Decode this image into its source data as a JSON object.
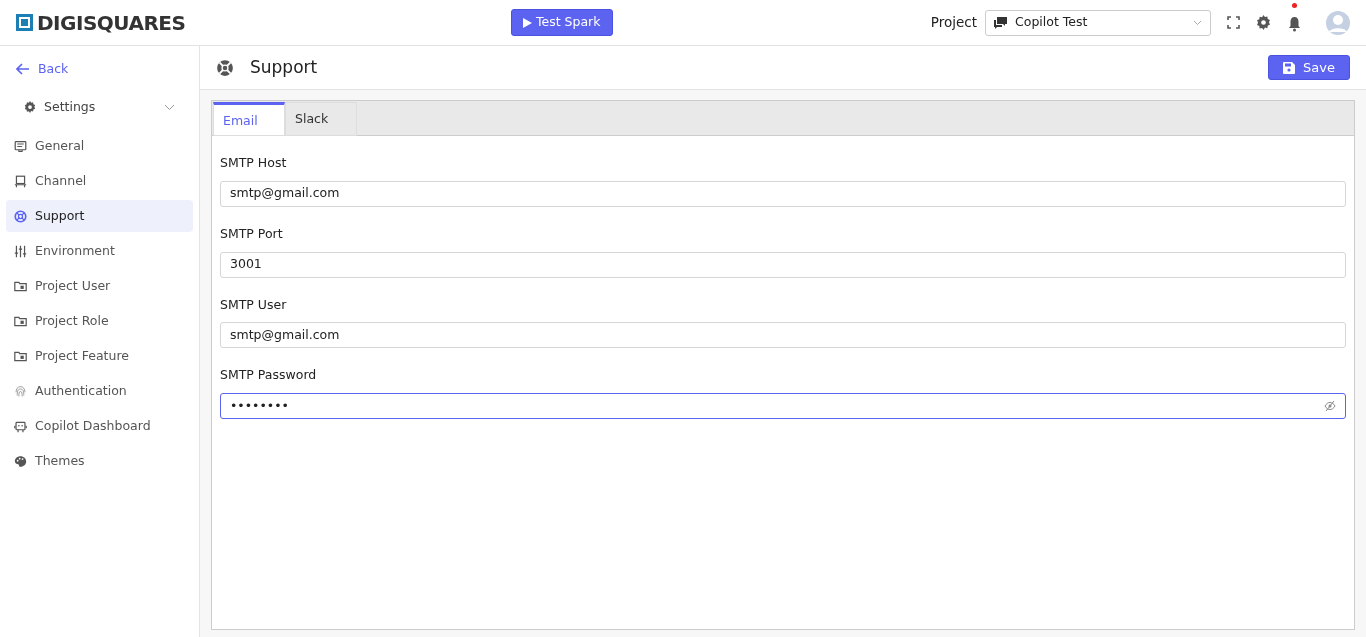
{
  "header": {
    "logo": "DIGISQUARES",
    "test_button": "Test Spark",
    "project_label": "Project",
    "project_select": "Copilot Test",
    "notification_dot": true
  },
  "sidebar": {
    "back": "Back",
    "group": {
      "label": "Settings",
      "expanded": true
    },
    "items": [
      {
        "label": "General",
        "selected": false
      },
      {
        "label": "Channel",
        "selected": false
      },
      {
        "label": "Support",
        "selected": true
      },
      {
        "label": "Environment",
        "selected": false
      },
      {
        "label": "Project User",
        "selected": false
      },
      {
        "label": "Project Role",
        "selected": false
      },
      {
        "label": "Project Feature",
        "selected": false
      },
      {
        "label": "Authentication",
        "selected": false
      },
      {
        "label": "Copilot Dashboard",
        "selected": false
      },
      {
        "label": "Themes",
        "selected": false
      }
    ]
  },
  "page": {
    "title": "Support",
    "save_button": "Save"
  },
  "tabs": [
    {
      "label": "Email",
      "selected": true
    },
    {
      "label": "Slack",
      "selected": false
    }
  ],
  "fields": [
    {
      "label": "SMTP Host",
      "value": "smtp@gmail.com",
      "kind": "text",
      "focused": false
    },
    {
      "label": "SMTP Port",
      "value": "3001",
      "kind": "text",
      "focused": false
    },
    {
      "label": "SMTP User",
      "value": "smtp@gmail.com",
      "kind": "text",
      "focused": false
    },
    {
      "label": "SMTP Password",
      "value": "••••••••",
      "kind": "password",
      "focused": true
    }
  ]
}
